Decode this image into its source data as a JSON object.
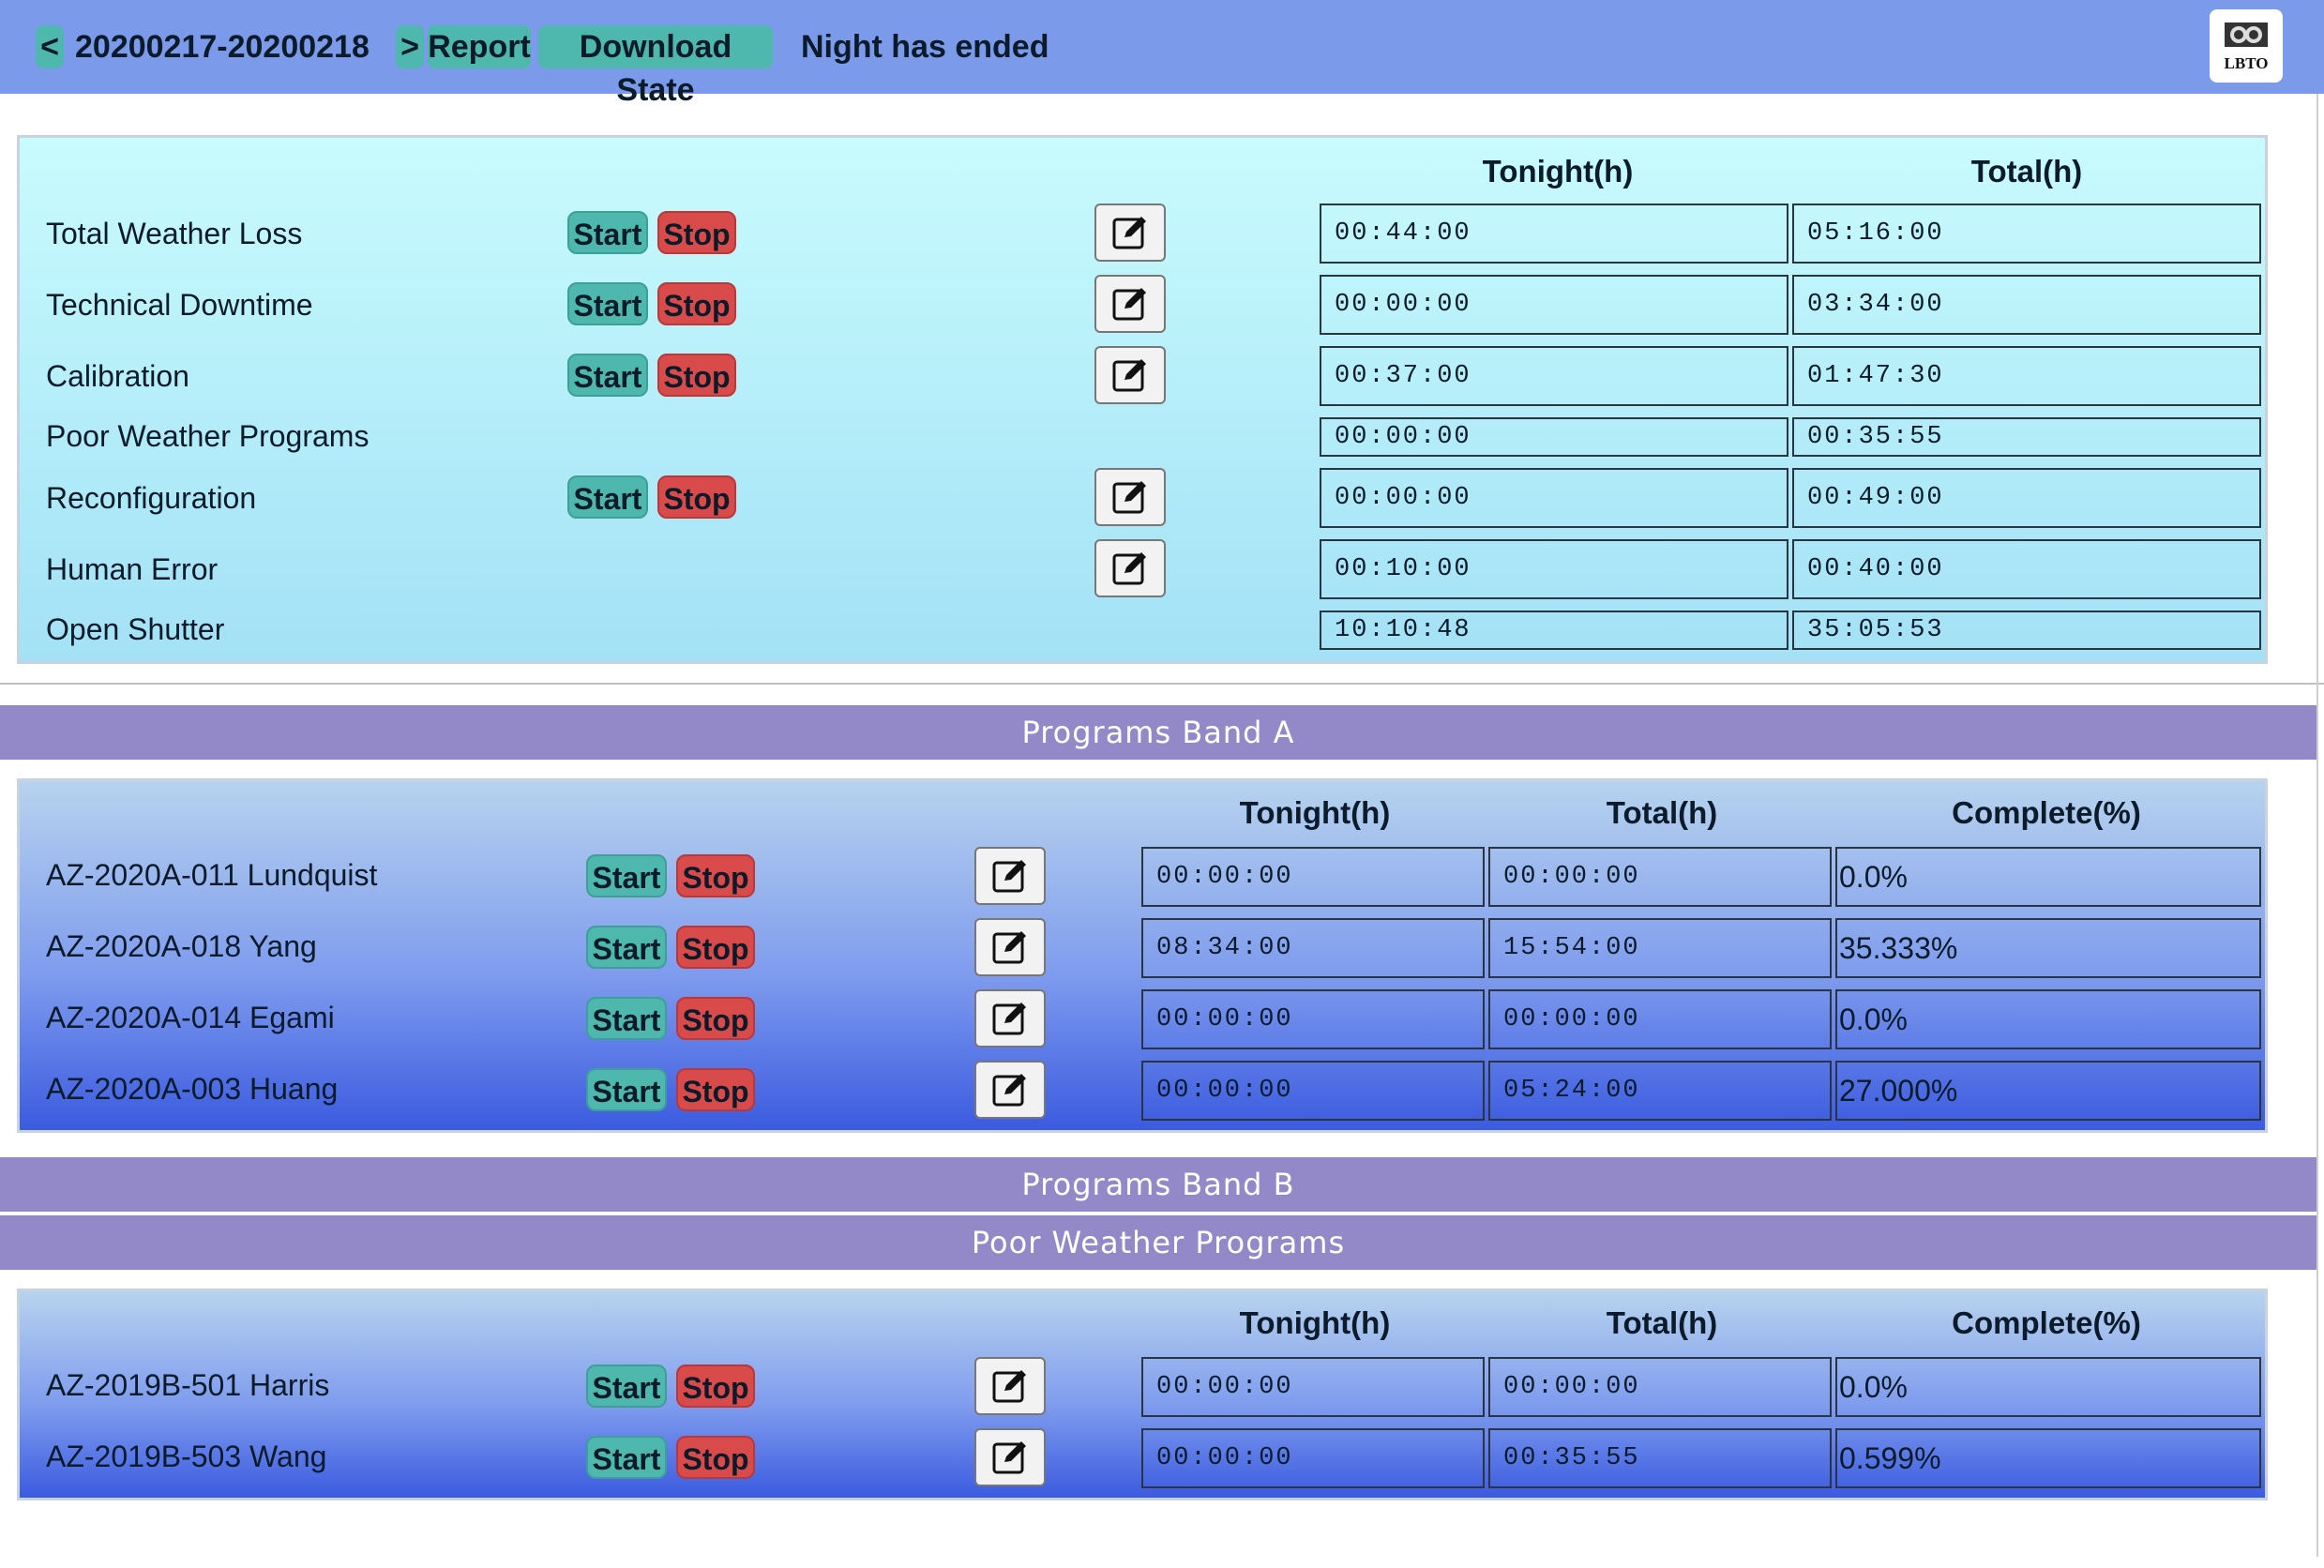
{
  "header": {
    "prev_label": "<",
    "date": "20200217-20200218",
    "next_label": ">",
    "report_label": "Report",
    "download_label": "Download State",
    "status": "Night has ended",
    "logo_text": "LBTO"
  },
  "time_accounting": {
    "col_tonight": "Tonight(h)",
    "col_total": "Total(h)",
    "start_label": "Start",
    "stop_label": "Stop",
    "rows": [
      {
        "label": "Total Weather Loss",
        "tonight": "00:44:00",
        "total": "05:16:00"
      },
      {
        "label": "Technical Downtime",
        "tonight": "00:00:00",
        "total": "03:34:00"
      },
      {
        "label": "Calibration",
        "tonight": "00:37:00",
        "total": "01:47:30"
      },
      {
        "label": "Poor Weather Programs",
        "tonight": "00:00:00",
        "total": "00:35:55"
      },
      {
        "label": "Reconfiguration",
        "tonight": "00:00:00",
        "total": "00:49:00"
      },
      {
        "label": "Human Error",
        "tonight": "00:10:00",
        "total": "00:40:00"
      },
      {
        "label": "Open Shutter",
        "tonight": "10:10:48",
        "total": "35:05:53"
      }
    ]
  },
  "band_a": {
    "title": "Programs Band A",
    "col_tonight": "Tonight(h)",
    "col_total": "Total(h)",
    "col_complete": "Complete(%)",
    "start_label": "Start",
    "stop_label": "Stop",
    "rows": [
      {
        "label": "AZ-2020A-011 Lundquist",
        "tonight": "00:00:00",
        "total": "00:00:00",
        "complete": "0.0%"
      },
      {
        "label": "AZ-2020A-018 Yang",
        "tonight": "08:34:00",
        "total": "15:54:00",
        "complete": "35.333%"
      },
      {
        "label": "AZ-2020A-014 Egami",
        "tonight": "00:00:00",
        "total": "00:00:00",
        "complete": "0.0%"
      },
      {
        "label": "AZ-2020A-003 Huang",
        "tonight": "00:00:00",
        "total": "05:24:00",
        "complete": "27.000%"
      }
    ]
  },
  "band_b": {
    "title": "Programs Band B"
  },
  "poor_weather": {
    "title": "Poor Weather Programs",
    "col_tonight": "Tonight(h)",
    "col_total": "Total(h)",
    "col_complete": "Complete(%)",
    "start_label": "Start",
    "stop_label": "Stop",
    "rows": [
      {
        "label": "AZ-2019B-501 Harris",
        "tonight": "00:00:00",
        "total": "00:00:00",
        "complete": "0.0%"
      },
      {
        "label": "AZ-2019B-503 Wang",
        "tonight": "00:00:00",
        "total": "00:35:55",
        "complete": "0.599%"
      }
    ]
  }
}
